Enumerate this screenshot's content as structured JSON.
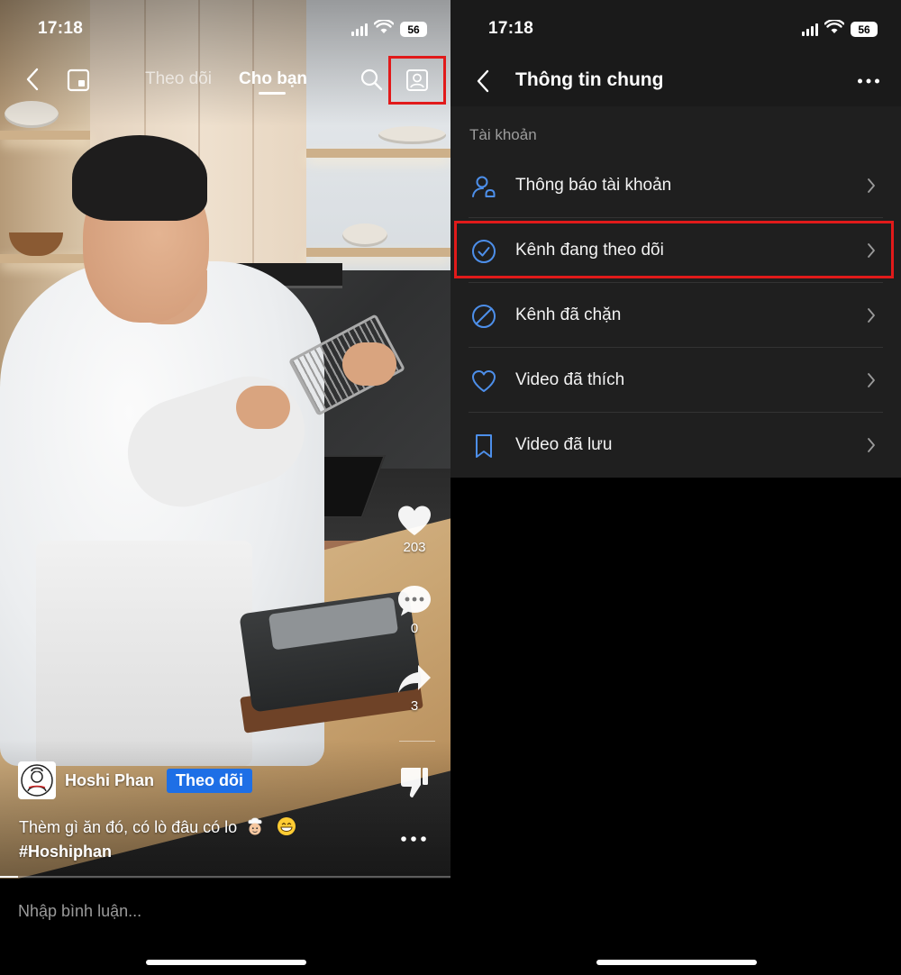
{
  "left_screen": {
    "status": {
      "time": "17:18",
      "battery": "56"
    },
    "feed_tabs": [
      {
        "label": "Theo dõi",
        "active": false
      },
      {
        "label": "Cho bạn",
        "active": true
      }
    ],
    "icons": {
      "back": "chevron-left-icon",
      "pip": "picture-in-picture-icon",
      "search": "search-icon",
      "profile": "profile-icon",
      "like": "heart-icon",
      "comment": "comment-bubble-icon",
      "share": "share-arrow-icon",
      "dislike": "thumbs-down-icon",
      "more": "more-dots-icon"
    },
    "actions": {
      "likes": "203",
      "comments": "0",
      "shares": "3"
    },
    "author": {
      "name": "Hoshi Phan",
      "follow_label": "Theo dõi"
    },
    "caption": {
      "text": "Thèm gì ăn đó, có lò đâu có lo",
      "emojis": [
        "chef",
        "grin"
      ],
      "hashtag": "#Hoshiphan"
    },
    "progress": 0.04,
    "comment_placeholder": "Nhập bình luận..."
  },
  "right_screen": {
    "status": {
      "time": "17:18",
      "battery": "56"
    },
    "title": "Thông tin chung",
    "section": "Tài khoản",
    "menu_items": [
      {
        "label": "Thông báo tài khoản",
        "icon": "account-notification-icon"
      },
      {
        "label": "Kênh đang theo dõi",
        "icon": "check-circle-icon",
        "highlighted": true
      },
      {
        "label": "Kênh đã chặn",
        "icon": "block-icon"
      },
      {
        "label": "Video đã thích",
        "icon": "heart-outline-icon"
      },
      {
        "label": "Video đã lưu",
        "icon": "bookmark-icon"
      }
    ]
  },
  "colors": {
    "highlight": "#e11a1a",
    "follow_button": "#1e6fe6",
    "menu_icon": "#4d8fea",
    "panel": "#1f1f1f",
    "header": "#1a1a1a"
  }
}
